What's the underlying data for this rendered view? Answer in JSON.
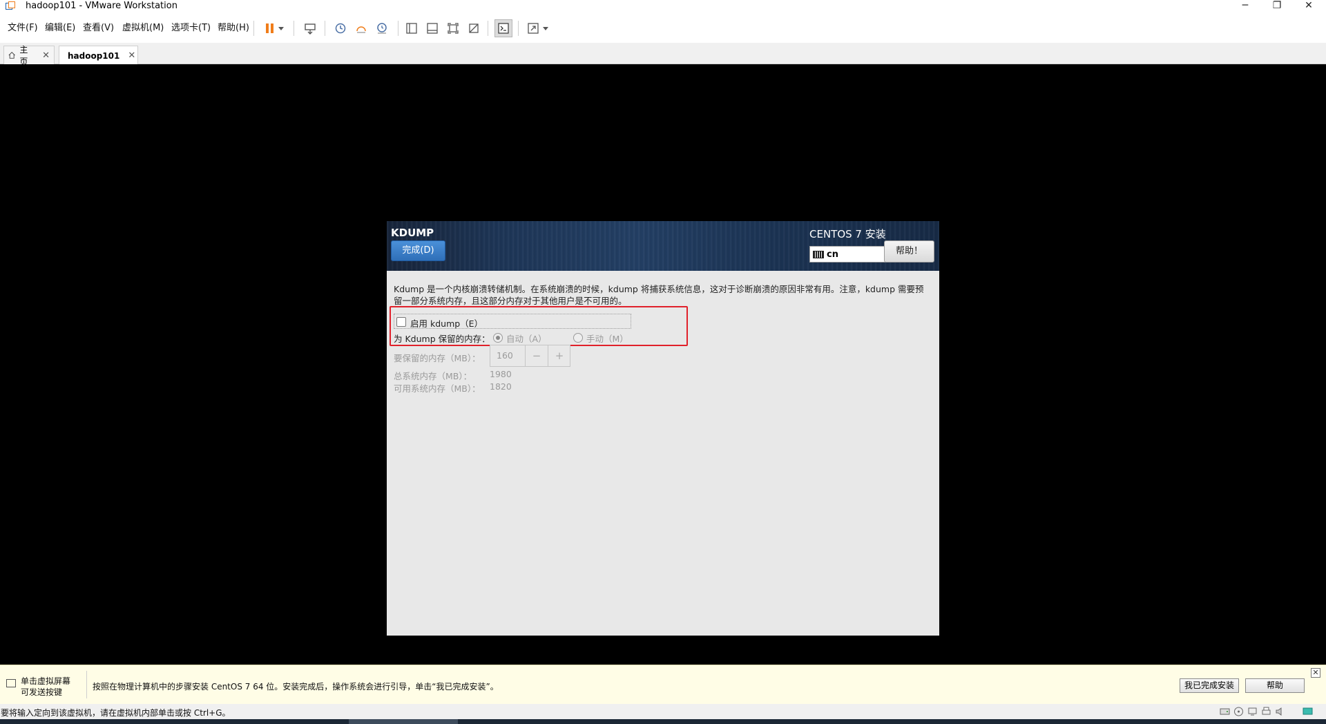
{
  "window": {
    "title": "hadoop101 - VMware Workstation",
    "minimize": "─",
    "restore": "❐",
    "close": "✕"
  },
  "menu": {
    "items": [
      "文件(F)",
      "编辑(E)",
      "查看(V)",
      "虚拟机(M)",
      "选项卡(T)",
      "帮助(H)"
    ]
  },
  "toolbar": {
    "icons": [
      "pause-icon",
      "dropdown-arrow-icon",
      "send-ctrl-alt-del-icon",
      "snapshot-icon",
      "revert-snapshot-icon",
      "snapshot-manager-icon",
      "library-icon",
      "thumbnail-bar-icon",
      "fullscreen-guest-icon",
      "unity-icon",
      "console-view-icon",
      "fit-window-icon",
      "dropdown-arrow-icon"
    ],
    "pause_color": "#f07d1a"
  },
  "tabs": [
    {
      "label": "主页",
      "icon": "home-icon",
      "close": "✕"
    },
    {
      "label": "hadoop101",
      "icon": "vm-icon",
      "close": "✕",
      "active": true
    }
  ],
  "installer": {
    "section_title": "KDUMP",
    "done_button": "完成(D)",
    "product_title": "CENTOS 7 安装",
    "keyboard_layout": "cn",
    "help_button": "帮助！",
    "description_line1": "Kdump 是一个内核崩溃转储机制。在系统崩溃的时候，kdump 将捕获系统信息，这对于诊断崩溃的原因非常有用。注意，kdump 需要预",
    "description_line2": "留一部分系统内存，且这部分内存对于其他用户是不可用的。",
    "enable_kdump_label": "启用 kdump（E）",
    "enable_kdump_checked": false,
    "reserve_label": "为 Kdump 保留的内存：",
    "auto_label": "自动（A）",
    "manual_label": "手动（M）",
    "selected_mode": "auto",
    "mem_to_reserve_label": "要保留的内存（MB）：",
    "mem_to_reserve_value": "160",
    "minus": "−",
    "plus": "+",
    "total_mem_label": "总系统内存（MB）：",
    "total_mem_value": "1980",
    "usable_mem_label": "可用系统内存（MB）：",
    "usable_mem_value": "1820",
    "highlight_color": "#e0202a",
    "header_accent": "#2f6fb8"
  },
  "hint": {
    "click_line1": "单击虚拟屏幕",
    "click_line2": "可发送按键",
    "message": "按照在物理计算机中的步骤安装 CentOS 7 64 位。安装完成后，操作系统会进行引导，单击“我已完成安装”。",
    "finish_button": "我已完成安装",
    "help_button": "帮助",
    "close": "✕"
  },
  "status": {
    "text": "要将输入定向到该虚拟机，请在虚拟机内部单击或按 Ctrl+G。",
    "icons": [
      "hard-disk-icon",
      "cd-icon",
      "network-icon",
      "printer-icon",
      "sound-icon",
      "message-icon"
    ]
  }
}
